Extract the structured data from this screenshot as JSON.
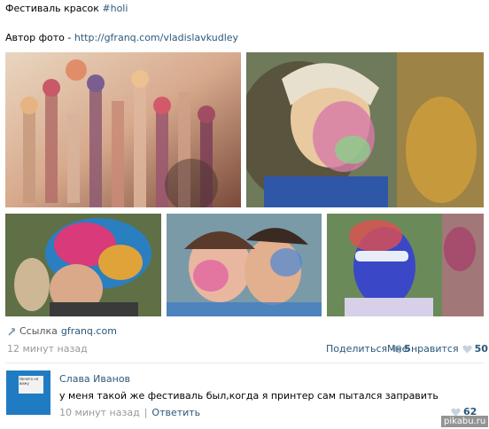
{
  "post": {
    "title_text": "Фестиваль красок",
    "hashtag": "#holi",
    "author_label": "Автор фото -",
    "author_link": "http://gfranq.com/vladislavkudley",
    "link_label": "Ссылка",
    "link_domain": "gfranq.com",
    "timestamp": "12 минут назад",
    "share_label": "Поделиться",
    "share_count": "5",
    "like_label": "Мне нравится",
    "like_count": "50"
  },
  "photos": [
    {
      "subject": "crowd of raised colorful hands"
    },
    {
      "subject": "woman with face painted in holi colors"
    },
    {
      "subject": "man with rainbow dyed hair"
    },
    {
      "subject": "smiling couple covered in paint"
    },
    {
      "subject": "man with sunglasses covered in blue paint"
    }
  ],
  "comment": {
    "author": "Слава Иванов",
    "text": "у меня такой же фестиваль был,когда я принтер сам пытался заправить",
    "timestamp": "10 минут назад",
    "separator": "|",
    "reply_label": "Ответить",
    "like_count": "62",
    "avatar_text": "Ничего не вижу"
  },
  "watermark": "pikabu.ru",
  "colors": {
    "link": "#2b587a",
    "muted": "#999999",
    "avatar_bg": "#1f7cc2"
  },
  "icons": {
    "link": "link-icon",
    "share": "megaphone-icon",
    "like": "heart-icon"
  }
}
